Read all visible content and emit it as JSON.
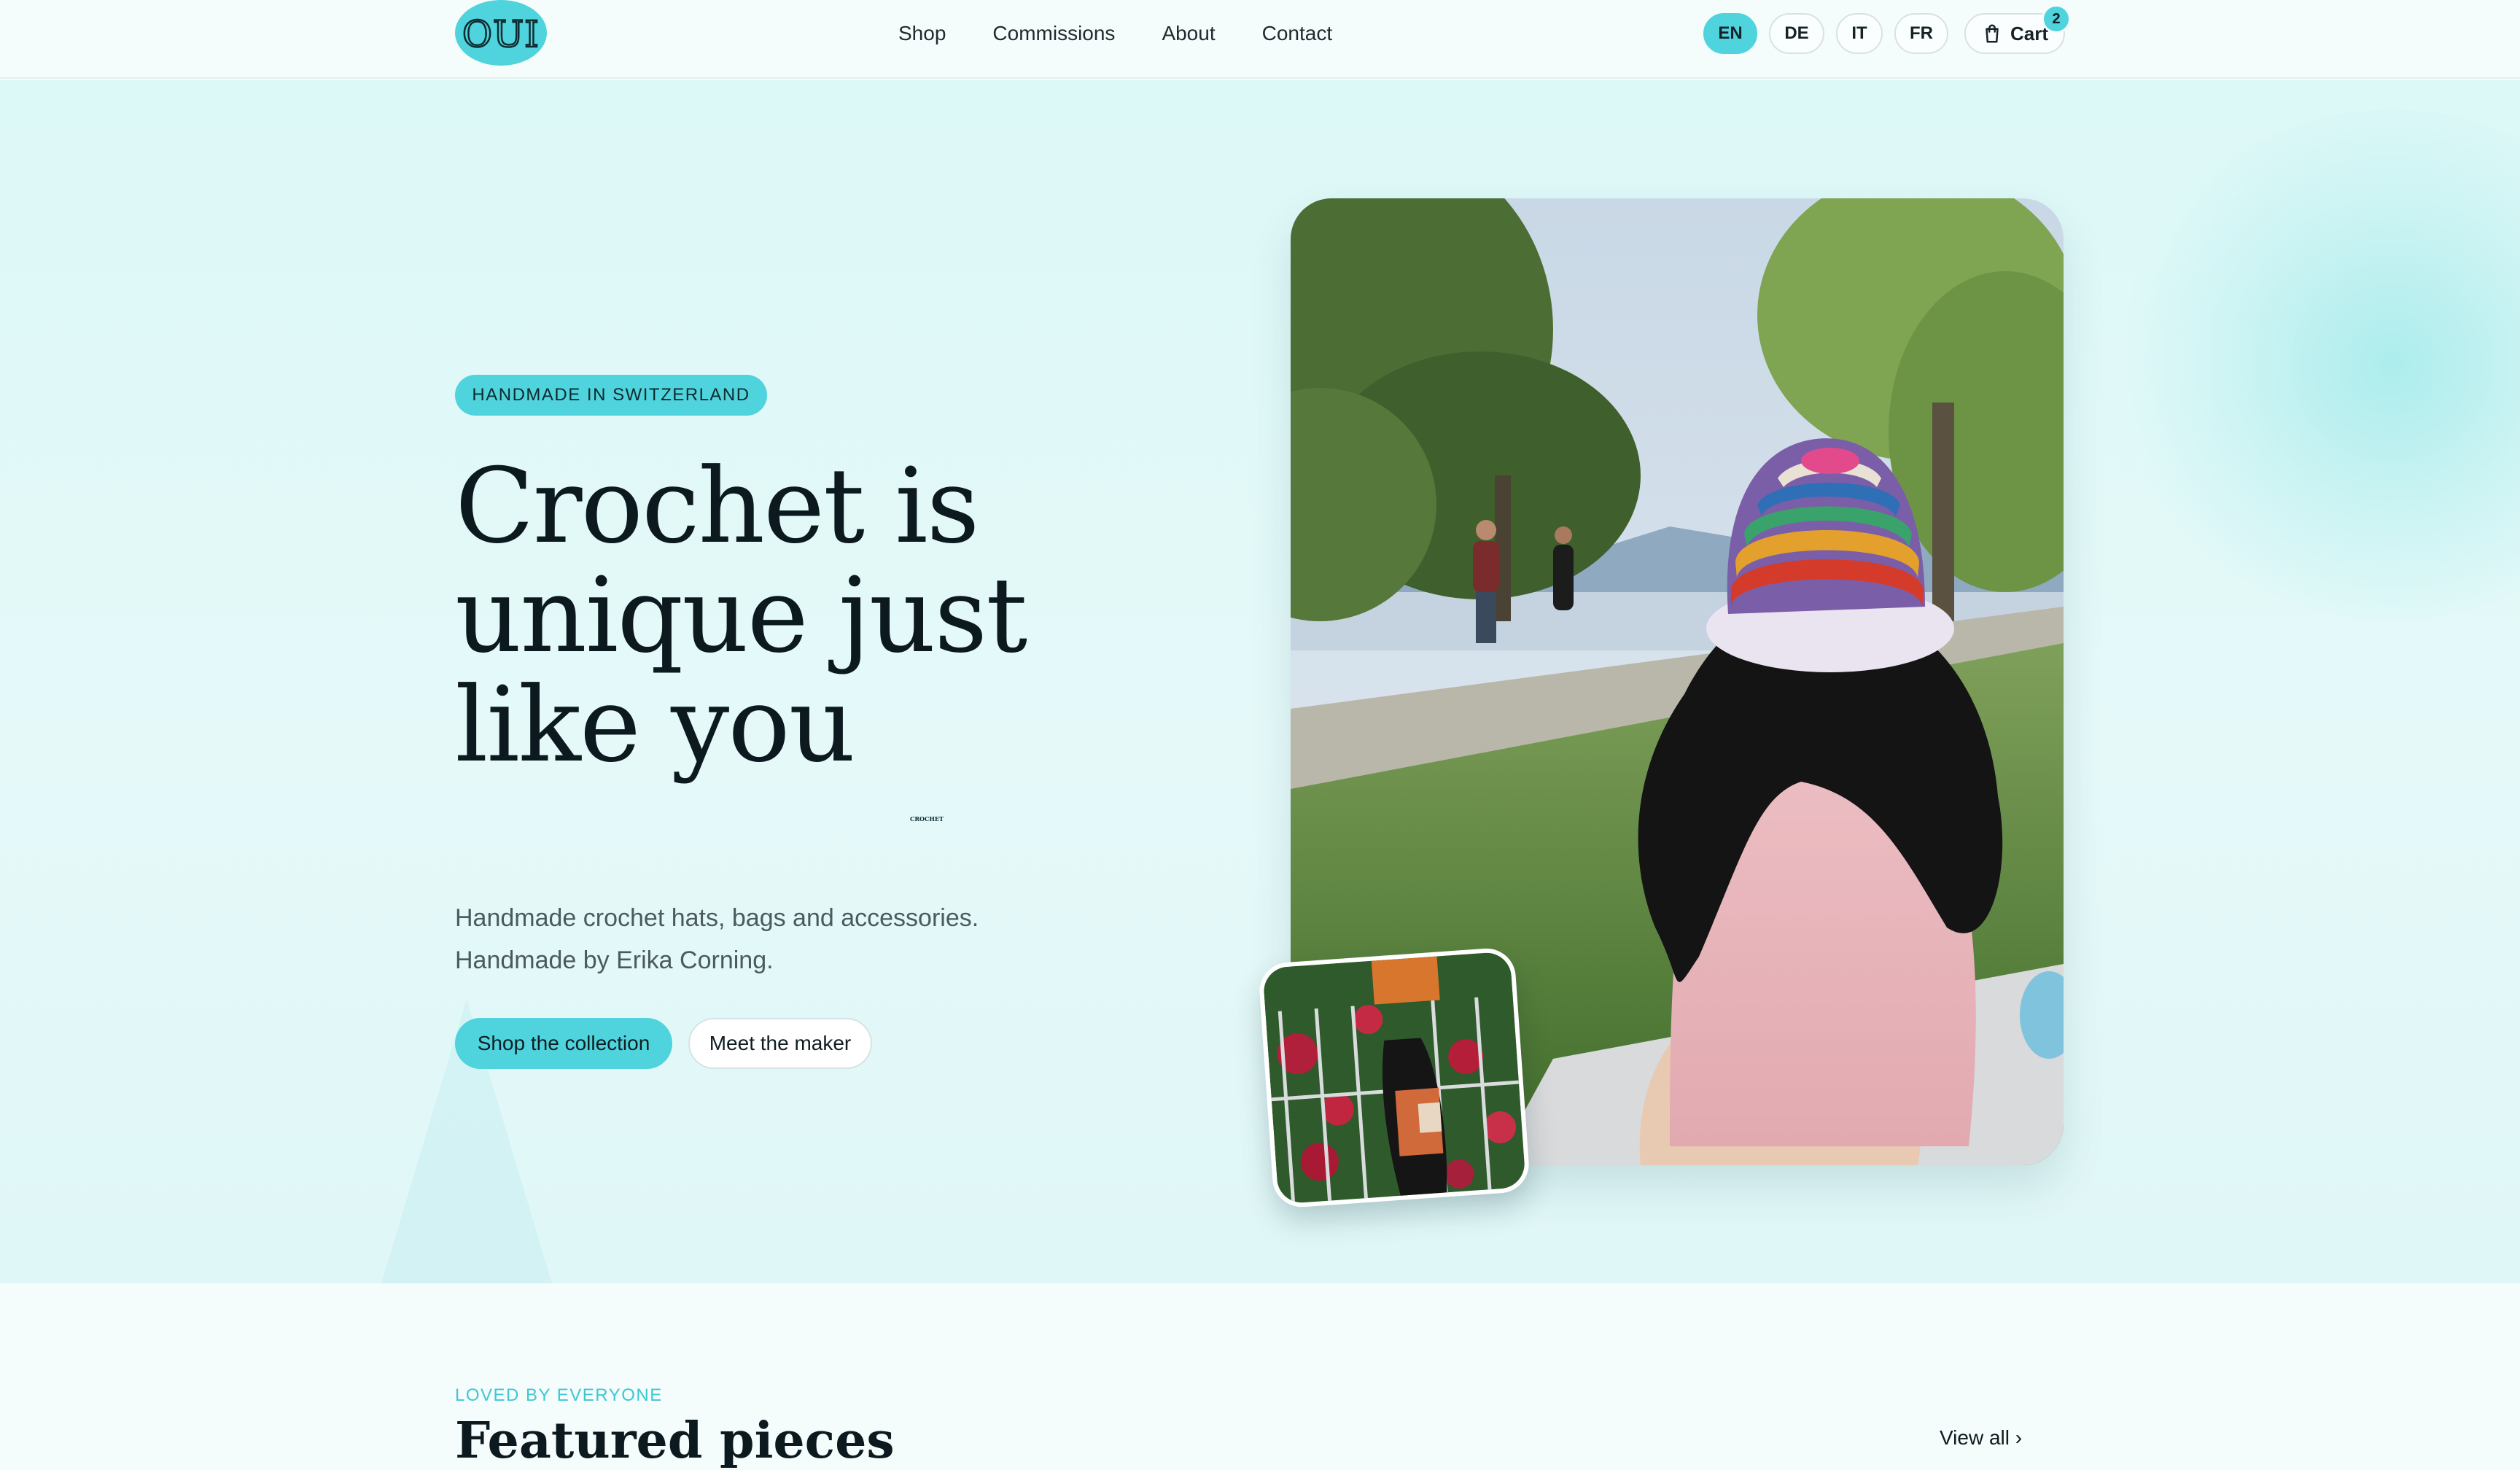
{
  "header": {
    "logo_text": "OUI",
    "logo_subtext": "CROCHET",
    "nav": [
      "Shop",
      "Commissions",
      "About",
      "Contact"
    ],
    "languages": [
      "EN",
      "DE",
      "IT",
      "FR"
    ],
    "active_language": "EN",
    "cart_label": "Cart",
    "cart_count": "2"
  },
  "hero": {
    "badge": "HANDMADE IN SWITZERLAND",
    "headline_line1": "Crochet is",
    "headline_line2": "unique just",
    "headline_line3": "like you",
    "subtitle_line1": "Handmade crochet hats, bags and accessories.",
    "subtitle_line2": "Handmade by Erika Corning.",
    "primary_cta": "Shop the collection",
    "secondary_cta": "Meet the maker"
  },
  "featured": {
    "eyebrow": "LOVED BY EVERYONE",
    "title": "Featured pieces",
    "view_all": "View all"
  },
  "colors": {
    "accent": "#4fd3dc",
    "hero_bg": "#dcf8f7",
    "text_dark": "#0c1a1f"
  }
}
